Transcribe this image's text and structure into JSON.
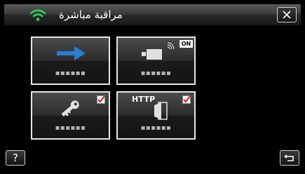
{
  "header": {
    "title": "مراقبة مباشرة",
    "wifi_icon": "wifi-icon",
    "close_icon": "close-icon"
  },
  "tiles": [
    {
      "icon": "arrow-right-icon",
      "label": "▪▪▪▪▪▪",
      "checked": false
    },
    {
      "icon": "camera-broadcast-icon",
      "badge": "ON",
      "label": "▪▪▪▪▪▪",
      "checked": false
    },
    {
      "icon": "key-icon",
      "label": "▪▪▪▪▪▪",
      "checked": true
    },
    {
      "icon": "http-door-icon",
      "badge": "HTTP",
      "label": "▪▪▪▪▪▪",
      "checked": true
    }
  ],
  "footer": {
    "help_label": "?",
    "back_icon": "return-icon"
  },
  "colors": {
    "wifi": "#2fd05a",
    "arrow": "#2a7dd6",
    "check": "#d21e1e"
  }
}
